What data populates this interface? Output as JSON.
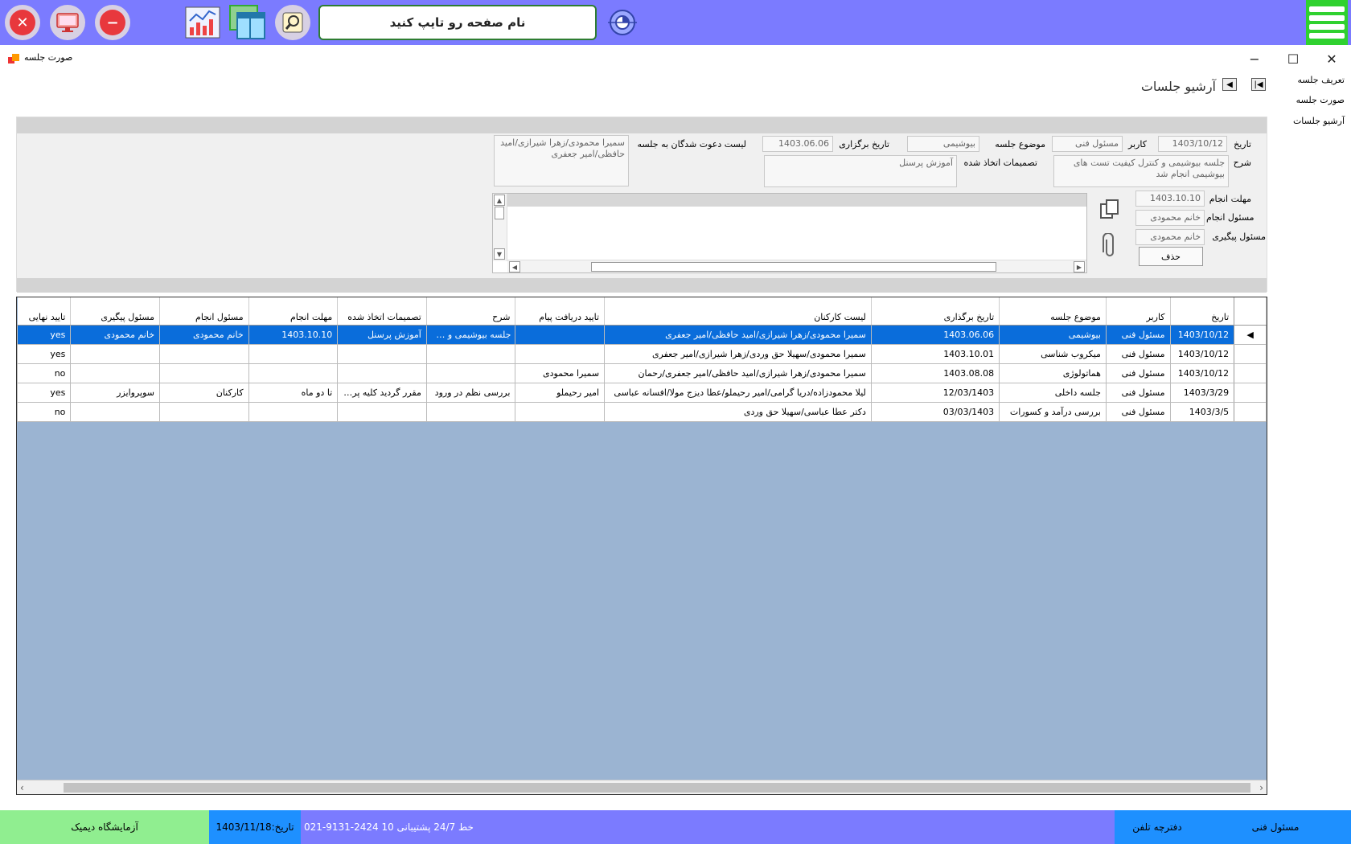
{
  "search": {
    "placeholder": "نام صفحه رو تایپ کنید"
  },
  "window": {
    "title": "صورت جلسه"
  },
  "nav": {
    "items": [
      "تعریف جلسه",
      "صورت جلسه",
      "آرشیو جلسات"
    ]
  },
  "page": {
    "heading": "آرشیو جلسات"
  },
  "form": {
    "date_label": "تاریخ",
    "date_value": "1403/10/12",
    "user_label": "کاربر",
    "user_value": "مسئول فنی",
    "topic_label": "موضوع جلسه",
    "topic_value": "بیوشیمی",
    "held_label": "تاریخ برگزاری",
    "held_value": "1403.06.06",
    "invitees_label": "لیست دعوت شدگان به جلسه",
    "invitees_value": "سمیرا محمودی/زهرا شیرازی/امید حافظی/امیر جعفری",
    "desc_label": "شرح",
    "desc_value": "جلسه بیوشیمی و کنترل کیفیت تست های بیوشیمی انجام شد",
    "decisions_label": "تصمیمات اتخاذ شده",
    "decisions_value": "آموزش پرسنل",
    "deadline_label": "مهلت انجام",
    "deadline_value": "1403.10.10",
    "executor_label": "مسئول انجام",
    "executor_value": "خانم محمودی",
    "followup_label": "مسئول پیگیری",
    "followup_value": "خانم محمودی",
    "delete_label": "حذف"
  },
  "grid": {
    "columns": [
      "تاریخ",
      "کاربر",
      "موضوع جلسه",
      "تاریخ برگذاری",
      "لیست کارکنان",
      "تایید دریافت پیام",
      "شرح",
      "تصمیمات اتخاذ شده",
      "مهلت انجام",
      "مسئول انجام",
      "مسئول پیگیری",
      "تایید نهایی"
    ],
    "rows": [
      [
        "1403/10/12",
        "مسئول فنی",
        "بیوشیمی",
        "1403.06.06",
        "سمیرا محمودی/زهرا شیرازی/امید حافظی/امیر جعفری",
        "",
        "جلسه بیوشیمی و کنترل کیفیت",
        "آموزش پرسنل",
        "1403.10.10",
        "خانم محمودی",
        "خانم محمودی",
        "yes"
      ],
      [
        "1403/10/12",
        "مسئول فنی",
        "میکروب شناسی",
        "1403.10.01",
        "سمیرا محمودی/سهیلا حق وردی/زهرا شیرازی/امیر جعفری",
        "",
        "",
        "",
        "",
        "",
        "",
        "yes"
      ],
      [
        "1403/10/12",
        "مسئول فنی",
        "هماتولوژی",
        "1403.08.08",
        "سمیرا محمودی/زهرا شیرازی/امید حافظی/امیر جعفری/رحمان",
        "سمیرا محمودی",
        "",
        "",
        "",
        "",
        "",
        "no"
      ],
      [
        "1403/3/29",
        "مسئول فنی",
        "جلسه داخلی",
        "12/03/1403",
        "لیلا محمودزاده/دریا گرامی/امیر رحیملو/عطا دیزج مولا/افسانه عباسی",
        "امیر رحیملو",
        "بررسی نظم در ورود",
        "مقرر گردید کلیه پرسنل",
        "تا دو ماه",
        "کارکنان",
        "سوپروایزر",
        "yes"
      ],
      [
        "1403/3/5",
        "مسئول فنی",
        "بررسی درآمد و کسورات",
        "03/03/1403",
        "دکتر عطا عباسی/سهیلا حق وردی",
        "",
        "",
        "",
        "",
        "",
        "",
        "no"
      ]
    ]
  },
  "status": {
    "lab_name": "آزمایشگاه دیمیک",
    "date": "تاریخ:1403/11/18",
    "support": "021-9131-2424   10 خط    24/7  پشتیبانی",
    "phonebook": "دفترچه تلفن",
    "user": "مسئول فنی"
  },
  "colors": {
    "topbar": "#7b7bff",
    "menu": "#2fd12f",
    "selected_row": "#0a6ddb",
    "grid_bg": "#9bb4d2",
    "status_green": "#90ee90",
    "status_blue": "#1e90ff"
  },
  "icons": [
    "close-icon",
    "monitor-icon",
    "minus-icon",
    "chart-icon",
    "window-layout-icon",
    "search-icon",
    "navigate-icon",
    "hamburger-icon",
    "copy-icon",
    "paperclip-icon"
  ]
}
